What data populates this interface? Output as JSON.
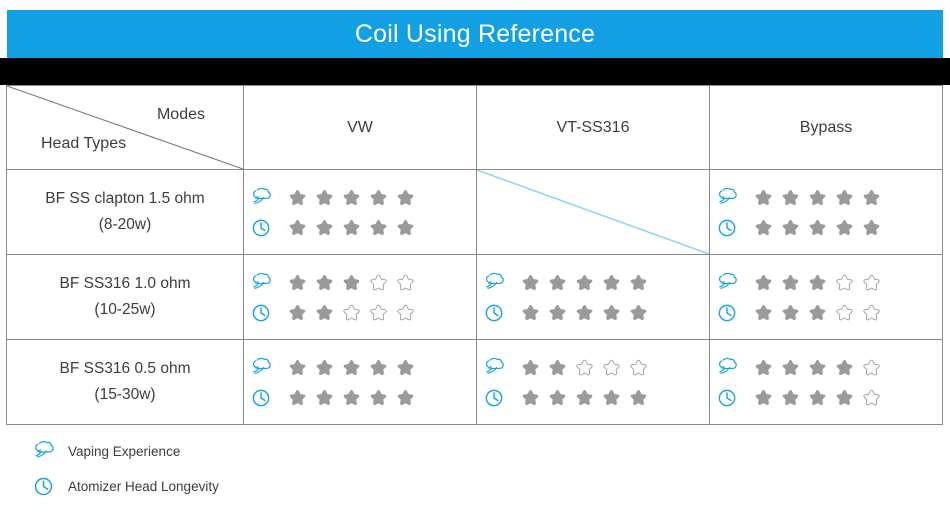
{
  "header": {
    "title": "Coil Using Reference",
    "bar_color": "#139fe3",
    "divider_color": "#000000"
  },
  "table": {
    "corner": {
      "modes_label": "Modes",
      "head_types_label": "Head Types"
    },
    "mode_columns": [
      {
        "label": "VW"
      },
      {
        "label": "VT-SS316"
      },
      {
        "label": "Bypass"
      }
    ],
    "rows": [
      {
        "head_type": "BF SS clapton 1.5 ohm",
        "wattage": "(8-20w)",
        "cells": [
          {
            "mode": "VW",
            "available": true,
            "vaping_experience": 5,
            "head_longevity": 5
          },
          {
            "mode": "VT-SS316",
            "available": false,
            "vaping_experience": 0,
            "head_longevity": 0
          },
          {
            "mode": "Bypass",
            "available": true,
            "vaping_experience": 5,
            "head_longevity": 5
          }
        ]
      },
      {
        "head_type": "BF SS316 1.0 ohm",
        "wattage": "(10-25w)",
        "cells": [
          {
            "mode": "VW",
            "available": true,
            "vaping_experience": 3,
            "head_longevity": 2
          },
          {
            "mode": "VT-SS316",
            "available": true,
            "vaping_experience": 5,
            "head_longevity": 5
          },
          {
            "mode": "Bypass",
            "available": true,
            "vaping_experience": 3,
            "head_longevity": 3
          }
        ]
      },
      {
        "head_type": "BF SS316 0.5 ohm",
        "wattage": "(15-30w)",
        "cells": [
          {
            "mode": "VW",
            "available": true,
            "vaping_experience": 5,
            "head_longevity": 5
          },
          {
            "mode": "VT-SS316",
            "available": true,
            "vaping_experience": 2,
            "head_longevity": 5
          },
          {
            "mode": "Bypass",
            "available": true,
            "vaping_experience": 4,
            "head_longevity": 4
          }
        ]
      }
    ],
    "max_stars": 5,
    "star_filled_color": "#9a9a9a",
    "star_empty_color": "#9a9a9a",
    "icon_color": "#17a3e0",
    "strikethrough_color": "#7fd4f2"
  },
  "legend": [
    {
      "icon": "vapor-cloud-icon",
      "label": "Vaping Experience"
    },
    {
      "icon": "clock-icon",
      "label": "Atomizer Head Longevity"
    }
  ]
}
